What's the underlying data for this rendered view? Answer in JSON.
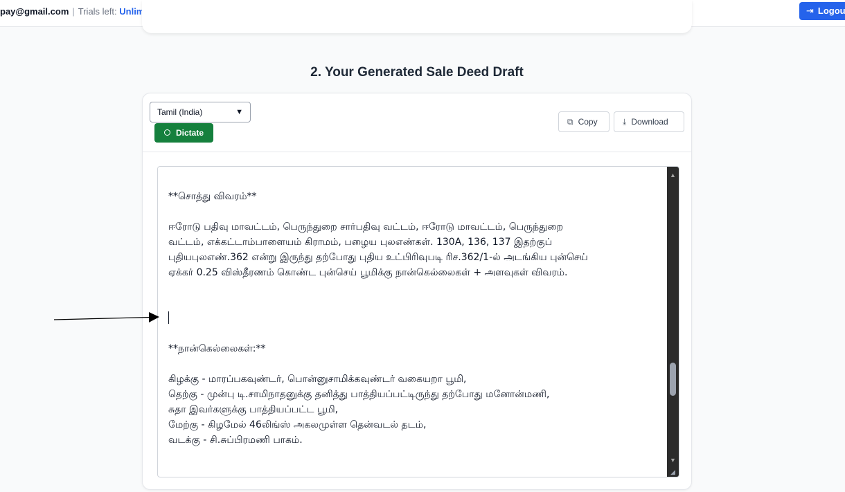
{
  "header": {
    "user_email": "pay@gmail.com",
    "separator": "|",
    "trials_label": "Trials left:",
    "trials_value": "Unlimited",
    "logout_label": "Logout",
    "logout_icon": "logout-icon"
  },
  "section": {
    "title": "2. Your Generated Sale Deed Draft"
  },
  "toolbar": {
    "language_selected": "Tamil (India)",
    "dictate_label": "Dictate",
    "copy_label": "Copy",
    "download_label": "Download"
  },
  "document": {
    "heading_property": "**சொத்து விவரம்**",
    "property_lines": [
      "ஈரோடு பதிவு மாவட்டம், பெருந்துறை சார்பதிவு வட்டம், ஈரோடு மாவட்டம், பெருந்துறை",
      "வட்டம், எக்கட்டாம்பாளையம் கிராமம், பழைய புலஎண்கள். 130A, 136, 137 இதற்குப்",
      "புதியபுலஎண்.362 என்று இருந்து தற்போது புதிய உட்பிரிவுபடி ரிச.362/1-ல் அடங்கிய புன்செய்",
      "ஏக்கர் 0.25 விஸ்தீரணம் கொண்ட புன்செய் பூமிக்கு நான்கெல்லைகள் + அளவுகள் விவரம்."
    ],
    "heading_boundaries": "**நான்கெல்லைகள்:**",
    "boundary_lines": [
      "கிழக்கு - மாரப்பகவுண்டர், பொன்னுசாமிக்கவுண்டர் வகையறா பூமி,",
      "தெற்கு - முன்பு டி.சாமிநாதனுக்கு தனித்து பாத்தியப்பட்டிருந்து தற்போது மனோன்மணி,",
      "சுதா இவர்களுக்கு பாத்தியப்பட்ட பூமி,",
      "மேற்கு - கிழமேல் 46லிங்ஸ் அகலமுள்ள தென்வடல் தடம்,",
      "வடக்கு - சி.சுப்பிரமணி பாகம்."
    ]
  },
  "icons": {
    "dropdown": "chevron-down-icon",
    "dictate": "record-icon",
    "copy": "copy-icon",
    "download": "download-icon",
    "scroll_up": "scroll-up-icon",
    "scroll_down": "scroll-down-icon",
    "resize": "resize-handle-icon"
  },
  "colors": {
    "primary": "#2563eb",
    "dictate": "#15803d",
    "scrollbar": "#2b2b2b"
  }
}
